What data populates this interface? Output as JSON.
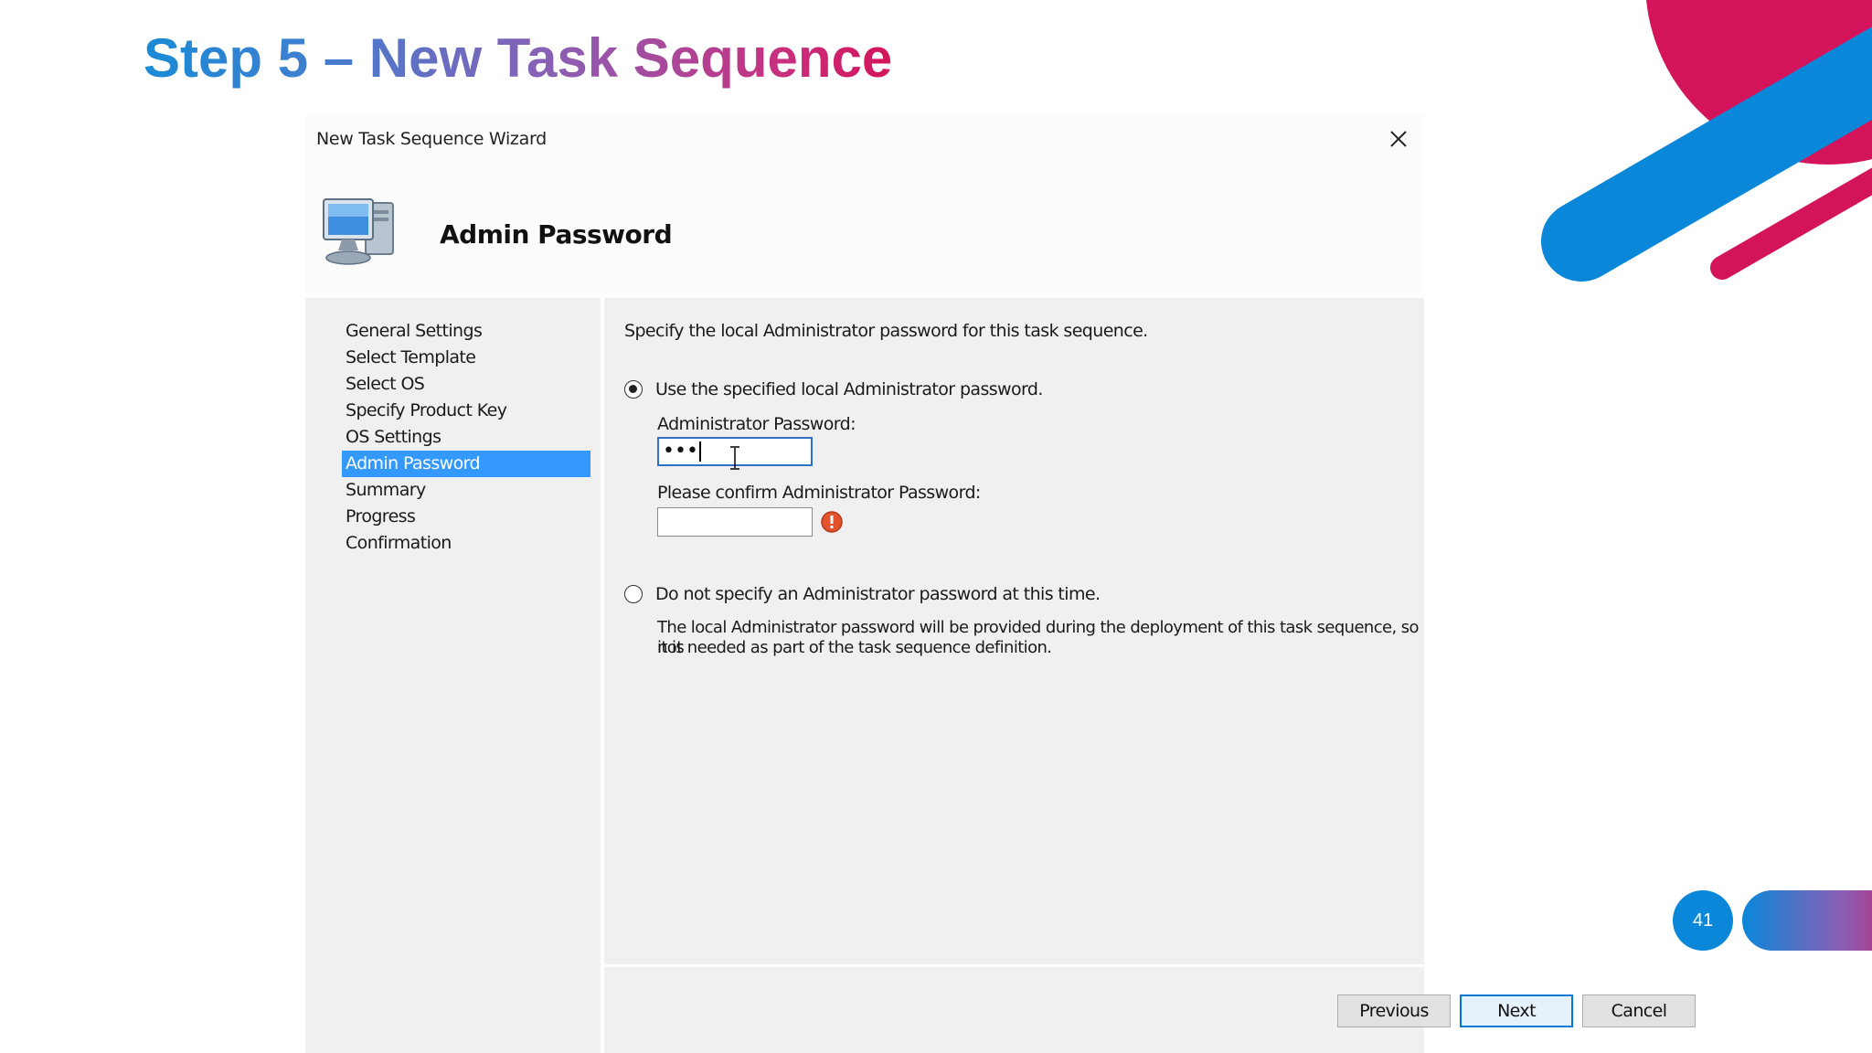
{
  "slide": {
    "title": "Step 5 – New Task Sequence",
    "page_number": "41",
    "colors": {
      "blue": "#0a87d9",
      "magenta": "#d4145a",
      "purple": "#8b5fb4"
    }
  },
  "wizard": {
    "window_title": "New Task Sequence Wizard",
    "close_icon": "close-icon",
    "header_icon": "computer-icon",
    "header_title": "Admin Password",
    "nav_items": [
      {
        "label": "General Settings",
        "active": false
      },
      {
        "label": "Select Template",
        "active": false
      },
      {
        "label": "Select OS",
        "active": false
      },
      {
        "label": "Specify Product Key",
        "active": false
      },
      {
        "label": "OS Settings",
        "active": false
      },
      {
        "label": "Admin Password",
        "active": true
      },
      {
        "label": "Summary",
        "active": false
      },
      {
        "label": "Progress",
        "active": false
      },
      {
        "label": "Confirmation",
        "active": false
      }
    ],
    "instruction": "Specify the local Administrator password for this task sequence.",
    "option_specify": {
      "label": "Use the specified local Administrator password.",
      "selected": true
    },
    "password_label": "Administrator Password:",
    "password_value": "•••",
    "confirm_label": "Please confirm Administrator Password:",
    "confirm_value": "",
    "error_icon": "error-icon",
    "option_none": {
      "label": "Do not specify an Administrator password at this time.",
      "selected": false
    },
    "option_none_desc_line1": "The local Administrator password will be provided during the deployment of this task sequence, so it is",
    "option_none_desc_line2": "not needed as part of the task sequence definition.",
    "buttons": {
      "previous": "Previous",
      "next": "Next",
      "cancel": "Cancel"
    },
    "selection_color": "#3399ff"
  }
}
